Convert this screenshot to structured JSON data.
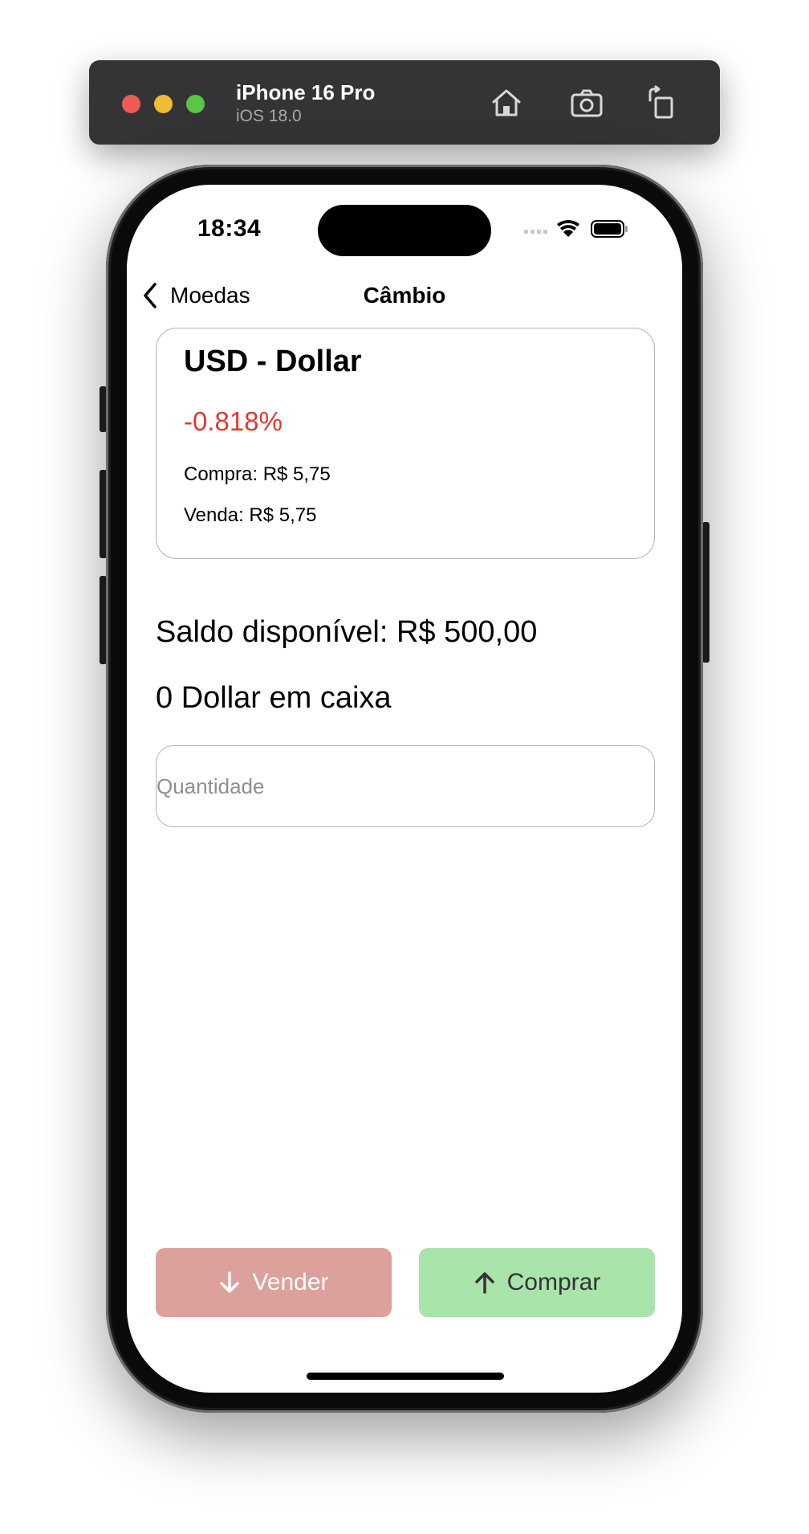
{
  "simulator": {
    "device_name": "iPhone 16 Pro",
    "os_version": "iOS 18.0",
    "icons": [
      "home-icon",
      "screenshot-icon",
      "rotate-icon"
    ]
  },
  "status_bar": {
    "time": "18:34",
    "icons": [
      "cellular-icon",
      "wifi-icon",
      "battery-icon"
    ]
  },
  "nav": {
    "back_label": "Moedas",
    "title": "Câmbio"
  },
  "currency_card": {
    "title": "USD - Dollar",
    "change": "-0.818%",
    "change_color": "#e5372e",
    "buy": "Compra: R$ 5,75",
    "sell": "Venda: R$ 5,75"
  },
  "balance_text": "Saldo disponível: R$ 500,00",
  "holdings_text": "0 Dollar em caixa",
  "quantity_input": {
    "value": "",
    "placeholder": "Quantidade"
  },
  "actions": {
    "sell_label": "Vender",
    "sell_color": "#dca19b",
    "buy_label": "Comprar",
    "buy_color": "#a9e4aa"
  }
}
